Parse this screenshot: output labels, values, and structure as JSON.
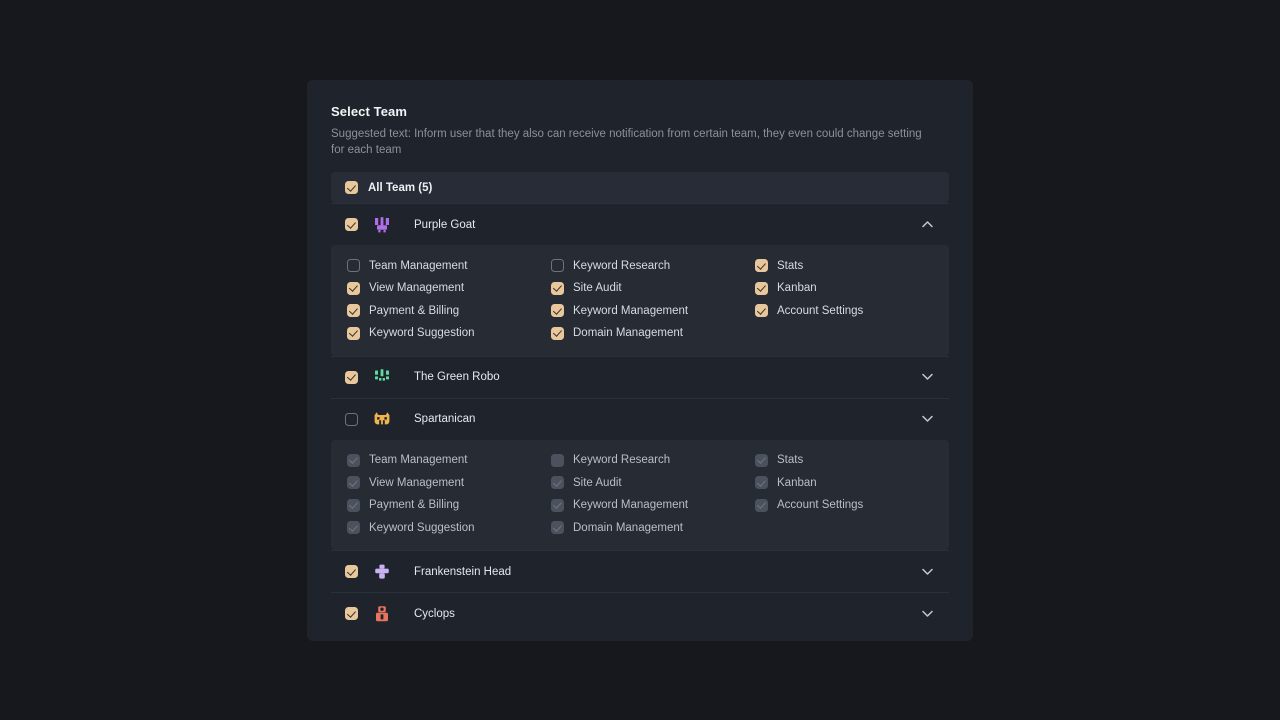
{
  "panel": {
    "title": "Select Team",
    "subtitle": "Suggested text: Inform user that they also can receive notification from certain team, they even could change setting for each team"
  },
  "all_team": {
    "label": "All Team (5)",
    "checked": true
  },
  "colors": {
    "page_background": "#16181d",
    "card_background": "#1f232b",
    "row_highlight": "#272c36",
    "permission_panel": "#262b34",
    "checkbox_accent": "#e8c79c",
    "checkbox_disabled": "#4b525e",
    "text_primary": "#e6e9ee",
    "text_muted": "#8b919c",
    "divider": "#2b313b",
    "logo_purple_goat": "#b06fe8",
    "logo_green_robo": "#5fd9a0",
    "logo_spartanican": "#f0b44c",
    "logo_frankenstein": "#c9b2f0",
    "logo_cyclops": "#e8735f"
  },
  "teams": [
    {
      "name": "Purple Goat",
      "checked": true,
      "expanded": true,
      "disabled": false,
      "logo": "purple-goat-logo",
      "chevron": "chevron-up-icon",
      "permissions": [
        {
          "label": "Team Management",
          "checked": false
        },
        {
          "label": "View Management",
          "checked": true
        },
        {
          "label": "Payment & Billing",
          "checked": true
        },
        {
          "label": "Keyword Suggestion",
          "checked": true
        },
        {
          "label": "Keyword Research",
          "checked": false
        },
        {
          "label": "Site Audit",
          "checked": true
        },
        {
          "label": "Keyword Management",
          "checked": true
        },
        {
          "label": "Domain Management",
          "checked": true
        },
        {
          "label": "Stats",
          "checked": true
        },
        {
          "label": "Kanban",
          "checked": true
        },
        {
          "label": "Account Settings",
          "checked": true
        }
      ]
    },
    {
      "name": "The Green Robo",
      "checked": true,
      "expanded": false,
      "disabled": false,
      "logo": "green-robo-logo",
      "chevron": "chevron-down-icon",
      "permissions": []
    },
    {
      "name": "Spartanican",
      "checked": false,
      "expanded": true,
      "disabled": true,
      "logo": "spartanican-logo",
      "chevron": "chevron-down-icon",
      "permissions": [
        {
          "label": "Team Management",
          "checked": true
        },
        {
          "label": "View Management",
          "checked": true
        },
        {
          "label": "Payment & Billing",
          "checked": true
        },
        {
          "label": "Keyword Suggestion",
          "checked": true
        },
        {
          "label": "Keyword Research",
          "checked": false
        },
        {
          "label": "Site Audit",
          "checked": true
        },
        {
          "label": "Keyword Management",
          "checked": true
        },
        {
          "label": "Domain Management",
          "checked": true
        },
        {
          "label": "Stats",
          "checked": true
        },
        {
          "label": "Kanban",
          "checked": true
        },
        {
          "label": "Account Settings",
          "checked": true
        }
      ]
    },
    {
      "name": "Frankenstein Head",
      "checked": true,
      "expanded": false,
      "disabled": false,
      "logo": "frankenstein-head-logo",
      "chevron": "chevron-down-icon",
      "permissions": []
    },
    {
      "name": "Cyclops",
      "checked": true,
      "expanded": false,
      "disabled": false,
      "logo": "cyclops-logo",
      "chevron": "chevron-down-icon",
      "permissions": []
    }
  ]
}
